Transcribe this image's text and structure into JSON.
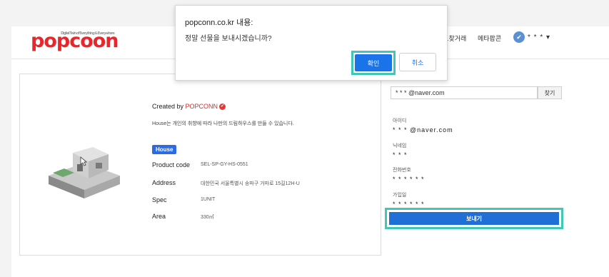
{
  "header": {
    "logo": "popcoon",
    "tagline": "Digital Twin of Everything & Everywhere",
    "nav_item_1": "...찾거래",
    "nav_item_2": "메타팝콘",
    "user_name": "* * * ▾"
  },
  "product": {
    "created_prefix": "Created by ",
    "creator": "POPCONN",
    "description": "House는 개인의 취향에 따라 나만의 드림하우스를 만들 수 있습니다.",
    "tag": "House",
    "specs": [
      {
        "key": "Product code",
        "value": "SEL-SP-GY-HS-0551"
      },
      {
        "key": "Address",
        "value": "대한민국 서울특별시 송파구 거마로 15길12H-U"
      },
      {
        "key": "Spec",
        "value": "1UNIT"
      },
      {
        "key": "Area",
        "value": "330㎡"
      }
    ]
  },
  "recipient": {
    "email_value": "* * * @naver.com",
    "find_label": "찾기",
    "fields": [
      {
        "label": "아이디",
        "value": "* * * @naver.com"
      },
      {
        "label": "닉네임",
        "value": "* * *"
      },
      {
        "label": "전화번호",
        "value": "* * * * * *"
      },
      {
        "label": "가입일",
        "value": "* * * * * *"
      }
    ],
    "send_label": "보내기"
  },
  "dialog": {
    "title": "popconn.co.kr 내용:",
    "message": "정말 선물을 보내시겠습니까?",
    "ok_label": "확인",
    "cancel_label": "취소"
  },
  "colors": {
    "brand": "#e8272d",
    "primary": "#1a73e8",
    "highlight": "#41c7b6"
  }
}
